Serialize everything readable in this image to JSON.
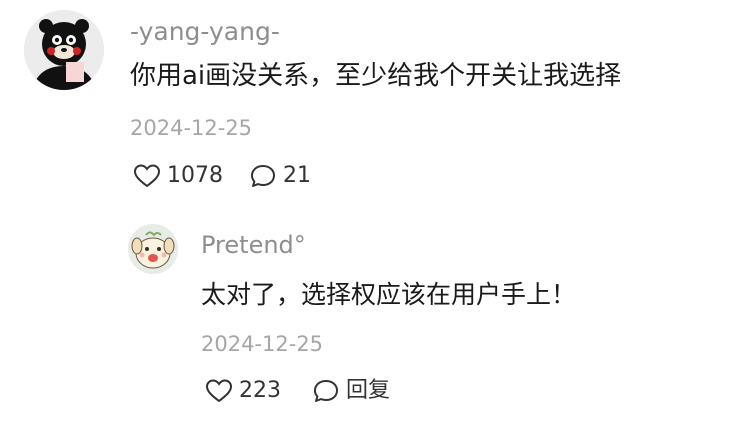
{
  "comment": {
    "username": "-yang-yang-",
    "text": "你用ai画没关系，至少给我个开关让我选择",
    "date": "2024-12-25",
    "likes": "1078",
    "replies": "21",
    "avatar_icon": "kumamon-bear-icon"
  },
  "reply": {
    "username": "Pretend°",
    "text": "太对了，选择权应该在用户手上！",
    "date": "2024-12-25",
    "likes": "223",
    "reply_label": "回复",
    "avatar_icon": "cartoon-dog-icon"
  },
  "colors": {
    "username": "#8e8e8e",
    "text": "#1a1a1a",
    "date": "#a6a6a6",
    "action": "#333333"
  }
}
